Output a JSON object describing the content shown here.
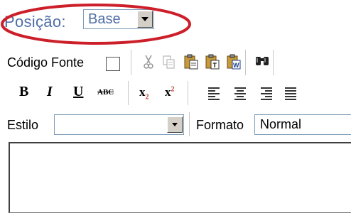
{
  "position": {
    "label": "Posição:",
    "selected": "Base"
  },
  "toolbar1": {
    "source_label": "Código Fonte",
    "source_checked": false,
    "icons": [
      "cut-icon",
      "copy-icon",
      "paste-icon",
      "paste-text-icon",
      "paste-word-icon",
      "find-icon"
    ]
  },
  "toolbar2": {
    "bold": "B",
    "italic": "I",
    "underline": "U",
    "strike": "ABC",
    "subscript_base": "x",
    "subscript_sub": "2",
    "superscript_base": "x",
    "superscript_sup": "2",
    "icons": [
      "align-left-icon",
      "align-center-icon",
      "align-right-icon",
      "align-justify-icon"
    ]
  },
  "toolbar3": {
    "style_label": "Estilo",
    "style_value": "",
    "format_label": "Formato",
    "format_value": "Normal"
  },
  "colors": {
    "accent_text": "#4f6ea6",
    "highlight": "#cc1f2a"
  }
}
